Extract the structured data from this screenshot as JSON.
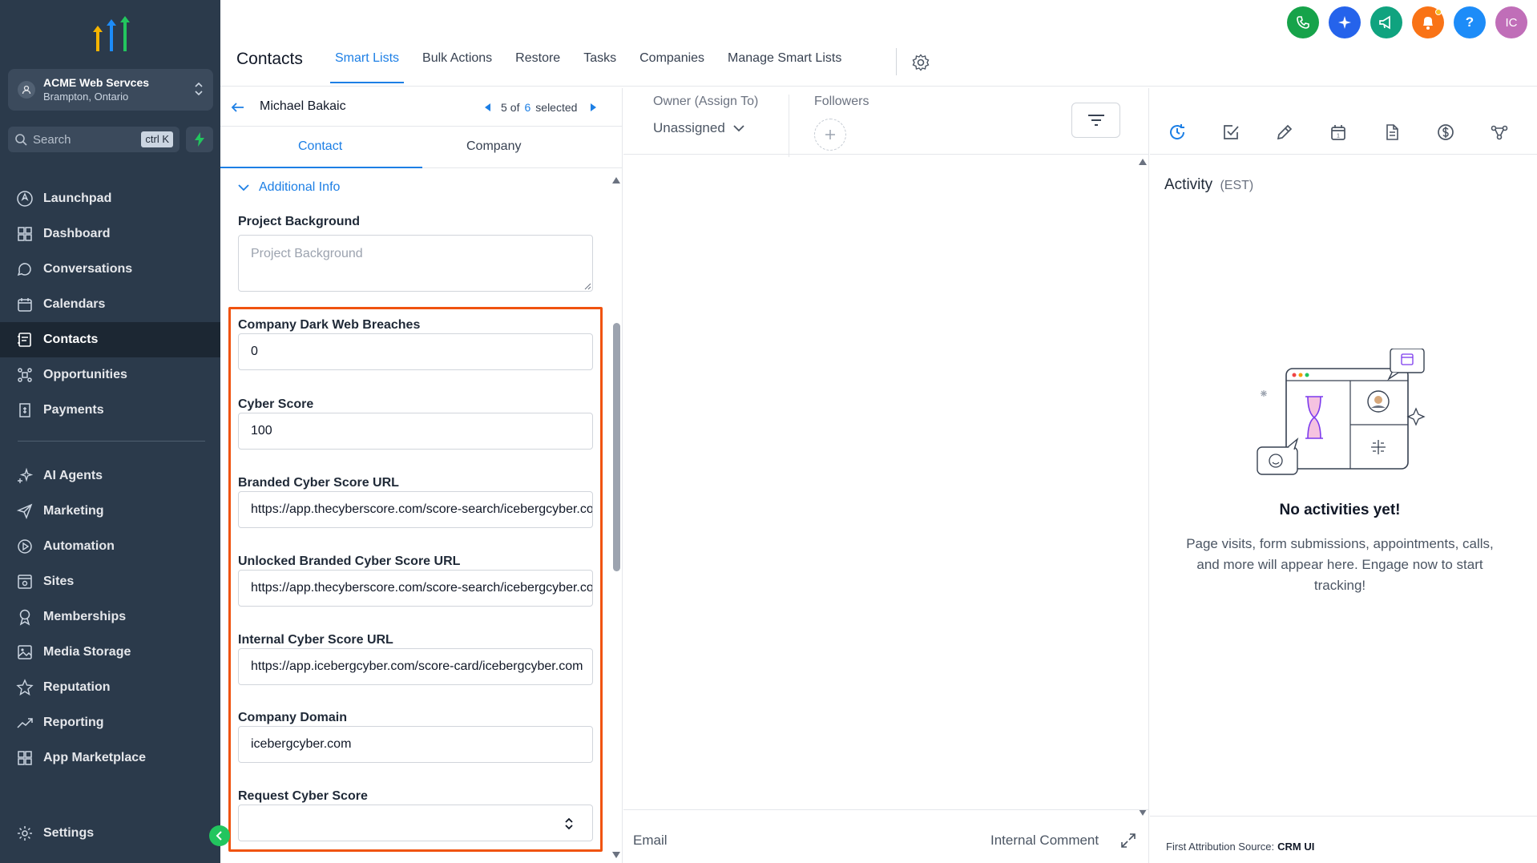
{
  "sidebar": {
    "location_name": "ACME Web Servces",
    "location_sub": "Brampton, Ontario",
    "search_placeholder": "Search",
    "search_shortcut": "ctrl K",
    "items": [
      {
        "label": "Launchpad",
        "icon": "rocket-icon"
      },
      {
        "label": "Dashboard",
        "icon": "grid-icon"
      },
      {
        "label": "Conversations",
        "icon": "chat-icon"
      },
      {
        "label": "Calendars",
        "icon": "calendar-icon"
      },
      {
        "label": "Contacts",
        "icon": "contact-card-icon",
        "active": true
      },
      {
        "label": "Opportunities",
        "icon": "opportunities-icon"
      },
      {
        "label": "Payments",
        "icon": "invoice-icon"
      }
    ],
    "items2": [
      {
        "label": "AI Agents",
        "icon": "sparkles-icon"
      },
      {
        "label": "Marketing",
        "icon": "send-icon"
      },
      {
        "label": "Automation",
        "icon": "automation-icon"
      },
      {
        "label": "Sites",
        "icon": "sites-icon"
      },
      {
        "label": "Memberships",
        "icon": "award-icon"
      },
      {
        "label": "Media Storage",
        "icon": "image-icon"
      },
      {
        "label": "Reputation",
        "icon": "star-icon"
      },
      {
        "label": "Reporting",
        "icon": "trend-icon"
      },
      {
        "label": "App Marketplace",
        "icon": "apps-icon"
      }
    ],
    "settings_label": "Settings"
  },
  "header": {
    "title": "Contacts",
    "tabs": [
      "Smart Lists",
      "Bulk Actions",
      "Restore",
      "Tasks",
      "Companies",
      "Manage Smart Lists"
    ],
    "active_tab": "Smart Lists",
    "avatar_initials": "IC",
    "help_label": "?",
    "colors": {
      "phone": "#16a34a",
      "ai": "#2563eb",
      "announce": "#10a37f",
      "bell": "#f97316",
      "help": "#1d8cf8",
      "avatar": "#c06eb8"
    }
  },
  "contact": {
    "name": "Michael Bakaic",
    "pager_current": "5",
    "pager_of": "of",
    "pager_total": "6",
    "pager_suffix": "selected",
    "subtabs": [
      "Contact",
      "Company"
    ],
    "section": "Additional Info",
    "fields": {
      "project_background": {
        "label": "Project Background",
        "placeholder": "Project Background"
      },
      "dark_web": {
        "label": "Company Dark Web Breaches",
        "value": "0"
      },
      "cyber_score": {
        "label": "Cyber Score",
        "value": "100"
      },
      "branded_url": {
        "label": "Branded Cyber Score URL",
        "value": "https://app.thecyberscore.com/score-search/icebergcyber.com"
      },
      "unlocked_url": {
        "label": "Unlocked Branded Cyber Score URL",
        "value": "https://app.thecyberscore.com/score-search/icebergcyber.com"
      },
      "internal_url": {
        "label": "Internal Cyber Score URL",
        "value": "https://app.icebergcyber.com/score-card/icebergcyber.com"
      },
      "domain": {
        "label": "Company Domain",
        "value": "icebergcyber.com"
      },
      "request": {
        "label": "Request Cyber Score",
        "value": ""
      }
    }
  },
  "middle": {
    "owner_label": "Owner (Assign To)",
    "owner_value": "Unassigned",
    "followers_label": "Followers",
    "email_tab": "Email",
    "comment_tab": "Internal Comment"
  },
  "activity": {
    "title": "Activity",
    "tz": "(EST)",
    "empty_title": "No activities yet!",
    "empty_text": "Page visits, form submissions, appointments, calls, and more will appear here. Engage now to start tracking!",
    "attribution_label": "First Attribution Source:",
    "attribution_value": "CRM UI"
  }
}
